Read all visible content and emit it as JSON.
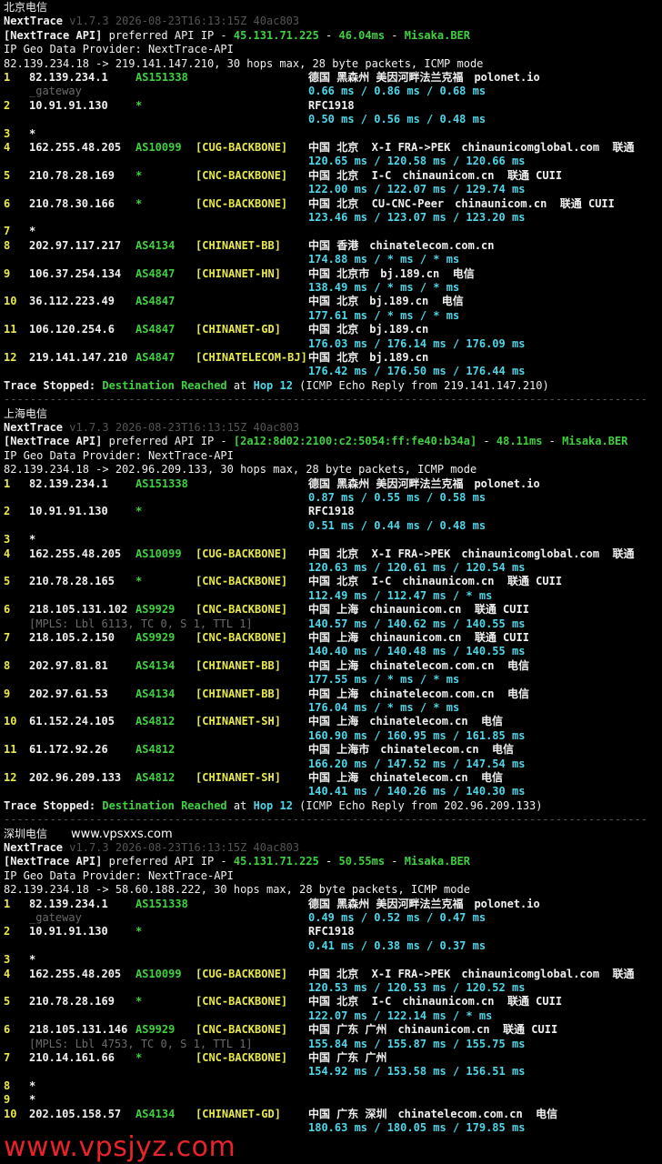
{
  "header_version": "v1.7.3 2026-08-23T16:13:15Z 40ac803",
  "app_name": "NextTrace",
  "geo_provider": "IP Geo Data Provider: NextTrace-API",
  "stopped_label": "Trace Stopped:",
  "dest_reached": "Destination Reached",
  "at_label": "at",
  "watermark_top": "www.vpsxxs.com",
  "watermark_bottom": "www.vpsjyz.com",
  "separator": "--------------------------------------------------------------------------------------------------",
  "sections": [
    {
      "title": "北京电信",
      "api_prefix": "[NextTrace API]",
      "api_text": " preferred API IP - ",
      "api_ip": "45.131.71.225",
      "api_dash1": " - ",
      "api_ms": "46.04ms",
      "api_dash2": " - ",
      "api_node": "Misaka.BER",
      "route_line": "82.139.234.18 -> 219.141.147.210, 30 hops max, 28 byte packets, ICMP mode",
      "hop_label": "Hop 12",
      "stop_tail": " (ICMP Echo Reply from 219.141.147.210)",
      "hops": [
        {
          "n": "1",
          "ip": "82.139.234.1",
          "as": "AS151338",
          "tag": "",
          "geo": "德国 黑森州 美因河畔法兰克福",
          "dom": "polonet.io",
          "rtt": "0.66 ms / 0.86 ms / 0.68 ms",
          "extra": "_gateway"
        },
        {
          "n": "2",
          "ip": "10.91.91.130",
          "as": "*",
          "tag": "",
          "geo": "RFC1918",
          "dom": "",
          "rtt": "0.50 ms / 0.56 ms / 0.48 ms",
          "extra": ""
        },
        {
          "n": "3",
          "ip": "*",
          "as": "",
          "tag": "",
          "geo": "",
          "dom": "",
          "rtt": "",
          "extra": ""
        },
        {
          "n": "4",
          "ip": "162.255.48.205",
          "as": "AS10099",
          "tag": "[CUG-BACKBONE]",
          "geo": "中国 北京  X-I FRA->PEK",
          "dom": "chinaunicomglobal.com  联通",
          "rtt": "120.65 ms / 120.58 ms / 120.66 ms",
          "extra": ""
        },
        {
          "n": "5",
          "ip": "210.78.28.169",
          "as": "*",
          "tag": "[CNC-BACKBONE]",
          "geo": "中国 北京  I-C",
          "dom": "chinaunicom.cn  联通 CUII",
          "rtt": "122.00 ms / 122.07 ms / 129.74 ms",
          "extra": ""
        },
        {
          "n": "6",
          "ip": "210.78.30.166",
          "as": "*",
          "tag": "[CNC-BACKBONE]",
          "geo": "中国 北京  CU-CNC-Peer",
          "dom": "chinaunicom.cn  联通 CUII",
          "rtt": "123.46 ms / 123.07 ms / 123.20 ms",
          "extra": ""
        },
        {
          "n": "7",
          "ip": "*",
          "as": "",
          "tag": "",
          "geo": "",
          "dom": "",
          "rtt": "",
          "extra": ""
        },
        {
          "n": "8",
          "ip": "202.97.117.217",
          "as": "AS4134",
          "tag": "[CHINANET-BB]",
          "geo": "中国 香港",
          "dom": "chinatelecom.com.cn",
          "rtt": "174.88 ms / * ms / * ms",
          "extra": ""
        },
        {
          "n": "9",
          "ip": "106.37.254.134",
          "as": "AS4847",
          "tag": "[CHINANET-HN]",
          "geo": "中国 北京市",
          "dom": "bj.189.cn  电信",
          "rtt": "138.49 ms / * ms / * ms",
          "extra": ""
        },
        {
          "n": "10",
          "ip": "36.112.223.49",
          "as": "AS4847",
          "tag": "",
          "geo": "中国 北京",
          "dom": "bj.189.cn  电信",
          "rtt": "177.61 ms / * ms / * ms",
          "extra": ""
        },
        {
          "n": "11",
          "ip": "106.120.254.6",
          "as": "AS4847",
          "tag": "[CHINANET-GD]",
          "geo": "中国 北京",
          "dom": "bj.189.cn",
          "rtt": "176.03 ms / 176.14 ms / 176.09 ms",
          "extra": ""
        },
        {
          "n": "12",
          "ip": "219.141.147.210",
          "as": "AS4847",
          "tag": "[CHINATELECOM-BJ]",
          "geo": "中国 北京",
          "dom": "bj.189.cn",
          "rtt": "176.42 ms / 176.50 ms / 176.44 ms",
          "extra": ""
        }
      ]
    },
    {
      "title": "上海电信",
      "api_prefix": "[NextTrace API]",
      "api_text": " preferred API IP - ",
      "api_ip": "[2a12:8d02:2100:c2:5054:ff:fe40:b34a]",
      "api_dash1": " - ",
      "api_ms": "48.11ms",
      "api_dash2": " - ",
      "api_node": "Misaka.BER",
      "route_line": "82.139.234.18 -> 202.96.209.133, 30 hops max, 28 byte packets, ICMP mode",
      "hop_label": "Hop 12",
      "stop_tail": " (ICMP Echo Reply from 202.96.209.133)",
      "hops": [
        {
          "n": "1",
          "ip": "82.139.234.1",
          "as": "AS151338",
          "tag": "",
          "geo": "德国 黑森州 美因河畔法兰克福",
          "dom": "polonet.io",
          "rtt": "0.87 ms / 0.55 ms / 0.58 ms",
          "extra": ""
        },
        {
          "n": "2",
          "ip": "10.91.91.130",
          "as": "*",
          "tag": "",
          "geo": "RFC1918",
          "dom": "",
          "rtt": "0.51 ms / 0.44 ms / 0.48 ms",
          "extra": ""
        },
        {
          "n": "3",
          "ip": "*",
          "as": "",
          "tag": "",
          "geo": "",
          "dom": "",
          "rtt": "",
          "extra": ""
        },
        {
          "n": "4",
          "ip": "162.255.48.205",
          "as": "AS10099",
          "tag": "[CUG-BACKBONE]",
          "geo": "中国 北京  X-I FRA->PEK",
          "dom": "chinaunicomglobal.com  联通",
          "rtt": "120.63 ms / 120.61 ms / 120.54 ms",
          "extra": ""
        },
        {
          "n": "5",
          "ip": "210.78.28.165",
          "as": "*",
          "tag": "[CNC-BACKBONE]",
          "geo": "中国 北京  I-C",
          "dom": "chinaunicom.cn  联通 CUII",
          "rtt": "112.49 ms / 112.47 ms / * ms",
          "extra": ""
        },
        {
          "n": "6",
          "ip": "218.105.131.102",
          "as": "AS9929",
          "tag": "[CNC-BACKBONE]",
          "geo": "中国 上海",
          "dom": "chinaunicom.cn  联通 CUII",
          "rtt": "140.57 ms / 140.62 ms / 140.55 ms",
          "extra": "[MPLS: Lbl 6113, TC 0, S 1, TTL 1]"
        },
        {
          "n": "7",
          "ip": "218.105.2.150",
          "as": "AS9929",
          "tag": "[CNC-BACKBONE]",
          "geo": "中国 上海",
          "dom": "chinaunicom.cn  联通 CUII",
          "rtt": "140.40 ms / 140.48 ms / 140.55 ms",
          "extra": ""
        },
        {
          "n": "8",
          "ip": "202.97.81.81",
          "as": "AS4134",
          "tag": "[CHINANET-BB]",
          "geo": "中国 上海",
          "dom": "chinatelecom.com.cn  电信",
          "rtt": "177.55 ms / * ms / * ms",
          "extra": ""
        },
        {
          "n": "9",
          "ip": "202.97.61.53",
          "as": "AS4134",
          "tag": "[CHINANET-BB]",
          "geo": "中国 上海",
          "dom": "chinatelecom.com.cn  电信",
          "rtt": "176.04 ms / * ms / * ms",
          "extra": ""
        },
        {
          "n": "10",
          "ip": "61.152.24.105",
          "as": "AS4812",
          "tag": "[CHINANET-SH]",
          "geo": "中国 上海",
          "dom": "chinatelecom.cn  电信",
          "rtt": "160.90 ms / 160.95 ms / 161.85 ms",
          "extra": ""
        },
        {
          "n": "11",
          "ip": "61.172.92.26",
          "as": "AS4812",
          "tag": "",
          "geo": "中国 上海市",
          "dom": "chinatelecom.cn  电信",
          "rtt": "166.20 ms / 147.52 ms / 147.54 ms",
          "extra": ""
        },
        {
          "n": "12",
          "ip": "202.96.209.133",
          "as": "AS4812",
          "tag": "[CHINANET-SH]",
          "geo": "中国 上海",
          "dom": "chinatelecom.cn  电信",
          "rtt": "140.41 ms / 140.26 ms / 140.30 ms",
          "extra": ""
        }
      ]
    },
    {
      "title": "深圳电信",
      "api_prefix": "[NextTrace API]",
      "api_text": " preferred API IP - ",
      "api_ip": "45.131.71.225",
      "api_dash1": " - ",
      "api_ms": "50.55ms",
      "api_dash2": " - ",
      "api_node": "Misaka.BER",
      "route_line": "82.139.234.18 -> 58.60.188.222, 30 hops max, 28 byte packets, ICMP mode",
      "hop_label": "",
      "stop_tail": "",
      "hops": [
        {
          "n": "1",
          "ip": "82.139.234.1",
          "as": "AS151338",
          "tag": "",
          "geo": "德国 黑森州 美因河畔法兰克福",
          "dom": "polonet.io",
          "rtt": "0.49 ms / 0.52 ms / 0.47 ms",
          "extra": "_gateway"
        },
        {
          "n": "2",
          "ip": "10.91.91.130",
          "as": "*",
          "tag": "",
          "geo": "RFC1918",
          "dom": "",
          "rtt": "0.41 ms / 0.38 ms / 0.37 ms",
          "extra": ""
        },
        {
          "n": "3",
          "ip": "*",
          "as": "",
          "tag": "",
          "geo": "",
          "dom": "",
          "rtt": "",
          "extra": ""
        },
        {
          "n": "4",
          "ip": "162.255.48.205",
          "as": "AS10099",
          "tag": "[CUG-BACKBONE]",
          "geo": "中国 北京  X-I FRA->PEK",
          "dom": "chinaunicomglobal.com  联通",
          "rtt": "120.53 ms / 120.53 ms / 120.52 ms",
          "extra": ""
        },
        {
          "n": "5",
          "ip": "210.78.28.169",
          "as": "*",
          "tag": "[CNC-BACKBONE]",
          "geo": "中国 北京  I-C",
          "dom": "chinaunicom.cn  联通 CUII",
          "rtt": "122.07 ms / 122.14 ms / * ms",
          "extra": ""
        },
        {
          "n": "6",
          "ip": "218.105.131.146",
          "as": "AS9929",
          "tag": "[CNC-BACKBONE]",
          "geo": "中国 广东 广州",
          "dom": "chinaunicom.cn  联通 CUII",
          "rtt": "155.84 ms / 155.87 ms / 155.75 ms",
          "extra": "[MPLS: Lbl 4753, TC 0, S 1, TTL 1]"
        },
        {
          "n": "7",
          "ip": "210.14.161.66",
          "as": "*",
          "tag": "[CNC-BACKBONE]",
          "geo": "中国 广东 广州",
          "dom": "",
          "rtt": "154.92 ms / 153.58 ms / 156.51 ms",
          "extra": ""
        },
        {
          "n": "8",
          "ip": "*",
          "as": "",
          "tag": "",
          "geo": "",
          "dom": "",
          "rtt": "",
          "extra": ""
        },
        {
          "n": "9",
          "ip": "*",
          "as": "",
          "tag": "",
          "geo": "",
          "dom": "",
          "rtt": "",
          "extra": ""
        },
        {
          "n": "10",
          "ip": "202.105.158.57",
          "as": "AS4134",
          "tag": "[CHINANET-GD]",
          "geo": "中国 广东 深圳",
          "dom": "chinatelecom.com.cn  电信",
          "rtt": "180.63 ms / 180.05 ms / 179.85 ms",
          "extra": ""
        }
      ]
    }
  ]
}
